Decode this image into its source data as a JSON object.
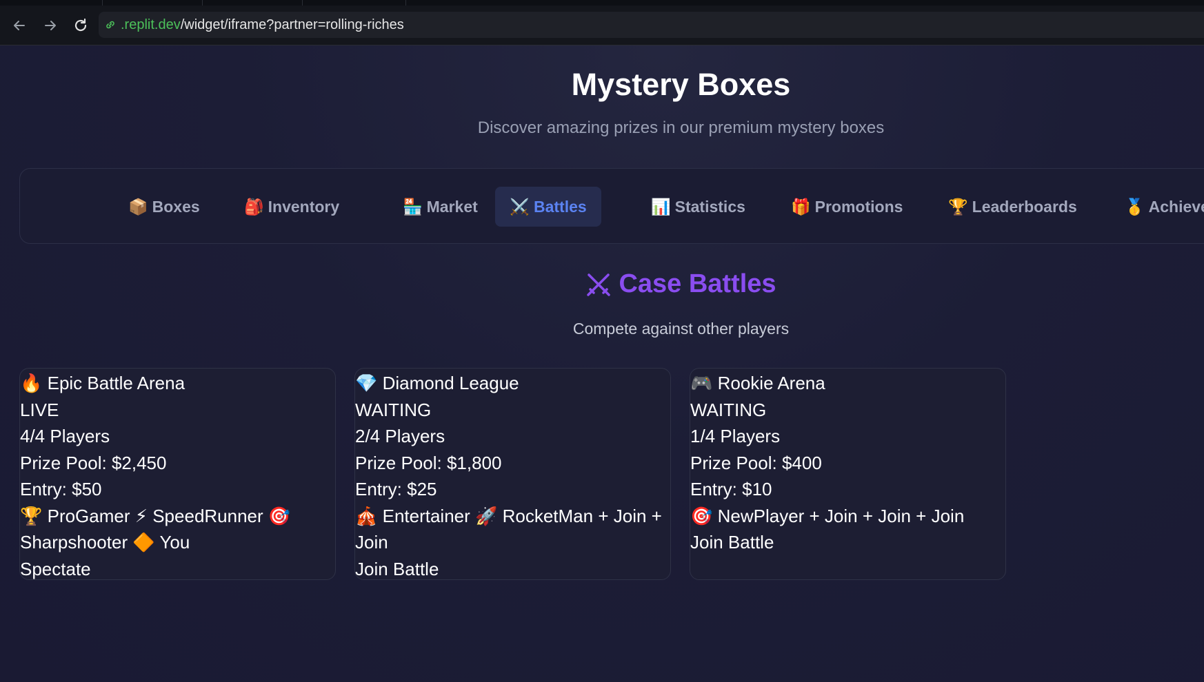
{
  "browser": {
    "url_host": ".replit.dev",
    "url_path": "/widget/iframe?partner=rolling-riches"
  },
  "header": {
    "title": "Mystery Boxes",
    "subtitle": "Discover amazing prizes in our premium mystery boxes"
  },
  "tabs": [
    {
      "emoji": "📦",
      "label": "Boxes"
    },
    {
      "emoji": "🎒",
      "label": "Inventory"
    },
    {
      "emoji": "🏪",
      "label": "Market"
    },
    {
      "emoji": "⚔️",
      "label": "Battles"
    },
    {
      "emoji": "📊",
      "label": "Statistics"
    },
    {
      "emoji": "🎁",
      "label": "Promotions"
    },
    {
      "emoji": "🏆",
      "label": "Leaderboards"
    },
    {
      "emoji": "🥇",
      "label": "Achieveme"
    }
  ],
  "active_tab": "Battles",
  "section": {
    "title": "Case Battles",
    "subtitle": "Compete against other players"
  },
  "battles": [
    {
      "name": "🔥 Epic Battle Arena",
      "status": "LIVE",
      "players": "4/4 Players",
      "prize_pool": "Prize Pool: $2,450",
      "entry": "Entry: $50",
      "roster": "🏆 ProGamer ⚡ SpeedRunner 🎯 Sharpshooter 🔶 You",
      "action": "Spectate"
    },
    {
      "name": "💎 Diamond League",
      "status": "WAITING",
      "players": "2/4 Players",
      "prize_pool": "Prize Pool: $1,800",
      "entry": "Entry: $25",
      "roster": "🎪 Entertainer 🚀 RocketMan + Join + Join",
      "action": "Join Battle"
    },
    {
      "name": "🎮 Rookie Arena",
      "status": "WAITING",
      "players": "1/4 Players",
      "prize_pool": "Prize Pool: $400",
      "entry": "Entry: $10",
      "roster": "🎯 NewPlayer + Join + Join + Join",
      "action": "Join Battle"
    }
  ]
}
